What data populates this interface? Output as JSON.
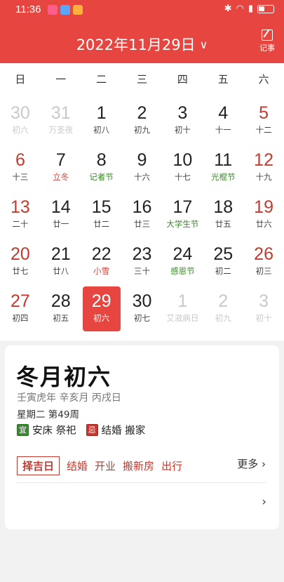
{
  "status_bar": {
    "time": "11:36",
    "icons": [
      "bluetooth-icon",
      "wifi-icon",
      "signal-icon",
      "battery-icon"
    ]
  },
  "header": {
    "date_title": "2022年11月29日",
    "memo_label": "记事"
  },
  "weekdays": [
    "日",
    "一",
    "二",
    "三",
    "四",
    "五",
    "六"
  ],
  "weeks": [
    [
      {
        "d": "30",
        "s": "初六",
        "type": "other"
      },
      {
        "d": "31",
        "s": "万圣夜",
        "type": "other"
      },
      {
        "d": "1",
        "s": "初八"
      },
      {
        "d": "2",
        "s": "初九"
      },
      {
        "d": "3",
        "s": "初十"
      },
      {
        "d": "4",
        "s": "十一"
      },
      {
        "d": "5",
        "s": "十二",
        "type": "weekend"
      }
    ],
    [
      {
        "d": "6",
        "s": "十三",
        "type": "weekend"
      },
      {
        "d": "7",
        "s": "立冬",
        "type": "term"
      },
      {
        "d": "8",
        "s": "记者节",
        "type": "festival"
      },
      {
        "d": "9",
        "s": "十六"
      },
      {
        "d": "10",
        "s": "十七"
      },
      {
        "d": "11",
        "s": "光棍节",
        "type": "festival"
      },
      {
        "d": "12",
        "s": "十九",
        "type": "weekend"
      }
    ],
    [
      {
        "d": "13",
        "s": "二十",
        "type": "weekend"
      },
      {
        "d": "14",
        "s": "廿一"
      },
      {
        "d": "15",
        "s": "廿二"
      },
      {
        "d": "16",
        "s": "廿三"
      },
      {
        "d": "17",
        "s": "大学生节",
        "type": "festival"
      },
      {
        "d": "18",
        "s": "廿五"
      },
      {
        "d": "19",
        "s": "廿六",
        "type": "weekend"
      }
    ],
    [
      {
        "d": "20",
        "s": "廿七",
        "type": "weekend"
      },
      {
        "d": "21",
        "s": "廿八"
      },
      {
        "d": "22",
        "s": "小雪",
        "type": "term"
      },
      {
        "d": "23",
        "s": "三十"
      },
      {
        "d": "24",
        "s": "感恩节",
        "type": "festival"
      },
      {
        "d": "25",
        "s": "初二"
      },
      {
        "d": "26",
        "s": "初三",
        "type": "weekend"
      }
    ],
    [
      {
        "d": "27",
        "s": "初四",
        "type": "weekend"
      },
      {
        "d": "28",
        "s": "初五"
      },
      {
        "d": "29",
        "s": "初六",
        "type": "selected"
      },
      {
        "d": "30",
        "s": "初七"
      },
      {
        "d": "1",
        "s": "艾滋病日",
        "type": "other"
      },
      {
        "d": "2",
        "s": "初九",
        "type": "other"
      },
      {
        "d": "3",
        "s": "初十",
        "type": "other"
      }
    ]
  ],
  "detail": {
    "lunar_date": "冬月初六",
    "ganzhi": "壬寅虎年  辛亥月  丙戌日",
    "week_info": "星期二  第49周",
    "yi_tag": "宜",
    "yi_items": "安床 祭祀",
    "ji_tag": "忌",
    "ji_items": "结婚 搬家",
    "pick_day": "择吉日",
    "actions": [
      "结婚",
      "开业",
      "搬新房",
      "出行"
    ],
    "more": "更多"
  },
  "colors": {
    "header_red": "#e6463f",
    "weekend_red": "#c53a2f",
    "festival_green": "#3a8a2a"
  }
}
